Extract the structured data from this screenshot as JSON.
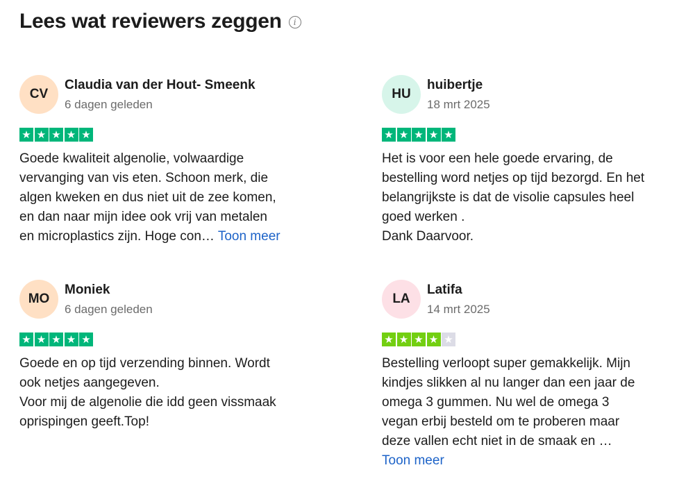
{
  "header": {
    "title": "Lees wat reviewers zeggen",
    "info_glyph": "i",
    "info_icon": "info-icon"
  },
  "colors": {
    "star_green_5": "#00b67a",
    "star_green_4": "#73cf11",
    "star_empty": "#dcdce6",
    "link": "#1d63c8"
  },
  "reviews": [
    {
      "initials": "CV",
      "avatar_color": "#ffe0c4",
      "name": "Claudia van der Hout- Smeenk",
      "date": "6 dagen geleden",
      "rating": 5,
      "text": "Goede kwaliteit algenolie, volwaardige\nvervanging van vis eten. Schoon merk, die\nalgen kweken en dus niet uit de zee komen,\nen dan naar mijn idee ook vrij van metalen\nen microplastics zijn. Hoge con… ",
      "more": "Toon meer"
    },
    {
      "initials": "HU",
      "avatar_color": "#d7f5ea",
      "name": "huibertje",
      "date": "18 mrt 2025",
      "rating": 5,
      "text": "Het is voor een hele goede ervaring, de\nbestelling word netjes op tijd bezorgd. En het\nbelangrijkste is dat de visolie capsules heel\ngoed werken .\nDank Daarvoor.",
      "more": ""
    },
    {
      "initials": "MO",
      "avatar_color": "#ffe0c4",
      "name": "Moniek",
      "date": "6 dagen geleden",
      "rating": 5,
      "text": "Goede en op tijd verzending binnen. Wordt\nook netjes aangegeven.\nVoor mij de algenolie die idd geen vissmaak\noprispingen geeft.Top!",
      "more": ""
    },
    {
      "initials": "LA",
      "avatar_color": "#fde0e6",
      "name": "Latifa",
      "date": "14 mrt 2025",
      "rating": 4,
      "text": "Bestelling verloopt super gemakkelijk. Mijn\nkindjes slikken al nu langer dan een jaar de\nomega 3 gummen. Nu wel de omega 3\nvegan erbij besteld om te proberen maar\ndeze vallen echt niet in de smaak en …\n",
      "more": "Toon meer"
    }
  ]
}
